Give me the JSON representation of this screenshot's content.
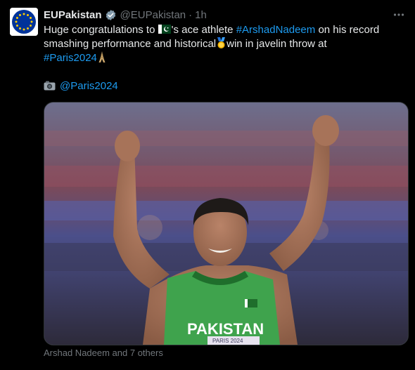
{
  "tweet": {
    "avatar_icon": "eu-flag-icon",
    "display_name": "EUPakistan",
    "verified_icon": "gray-verified-badge-icon",
    "handle": "@EUPakistan",
    "separator": "·",
    "time": "1h",
    "more_icon": "more-horizontal-icon",
    "text": {
      "line1_before": "Huge congratulations to ",
      "flag_emoji": "pakistan-flag-emoji",
      "line1_mid": "'s ace athlete ",
      "hashtag1": "#ArshadNadeem",
      "line1_after": " on his record",
      "line2_before": "smashing performance and historical",
      "medal_emoji": "gold-medal-emoji",
      "line2_after": "win in javelin throw at",
      "hashtag2": "#Paris2024",
      "tower_emoji": "eiffel-tower-emoji",
      "camera_emoji": "camera-emoji",
      "mention": "@Paris2024"
    },
    "media": {
      "jersey_text": "PAKISTAN",
      "bib_text": "PARIS 2024"
    },
    "tagged_people": "Arshad Nadeem and 7 others"
  },
  "colors": {
    "background": "#000000",
    "text": "#e7e9ea",
    "secondary": "#71767b",
    "link": "#1d9bf0",
    "jersey_green": "#3fa34d",
    "eu_blue": "#003399",
    "eu_gold": "#ffcc00"
  }
}
